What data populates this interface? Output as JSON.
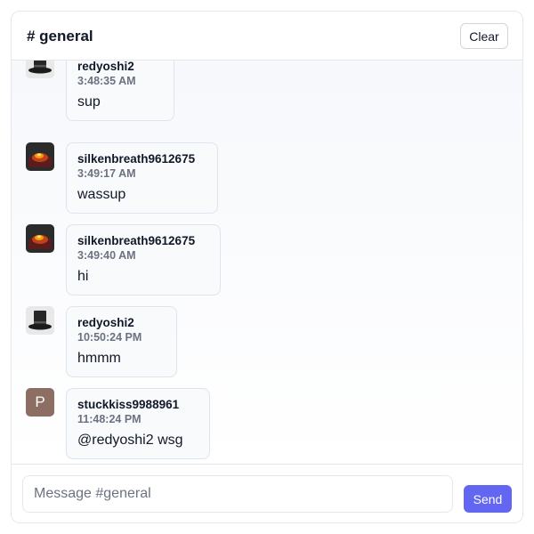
{
  "header": {
    "title": "# general",
    "clear_label": "Clear"
  },
  "messages": [
    {
      "user": "redyoshi2",
      "time": "3:48:35 AM",
      "text": "sup",
      "avatar": "top-hat-avatar"
    },
    {
      "user": "silkenbreath9612675",
      "time": "3:49:17 AM",
      "text": "wassup",
      "avatar": "fire-photo-avatar"
    },
    {
      "user": "silkenbreath9612675",
      "time": "3:49:40 AM",
      "text": "hi",
      "avatar": "fire-photo-avatar"
    },
    {
      "user": "redyoshi2",
      "time": "10:50:24 PM",
      "text": "hmmm",
      "avatar": "top-hat-avatar"
    },
    {
      "user": "stuckkiss9988961",
      "time": "11:48:24 PM",
      "text": "@redyoshi2 wsg",
      "avatar": "letter-avatar",
      "avatar_letter": "P"
    }
  ],
  "composer": {
    "placeholder": "Message #general",
    "value": "",
    "send_label": "Send"
  },
  "colors": {
    "accent": "#6366f1",
    "letter_avatar": "#8d6e63",
    "bubble_border": "#dbe4f0"
  }
}
